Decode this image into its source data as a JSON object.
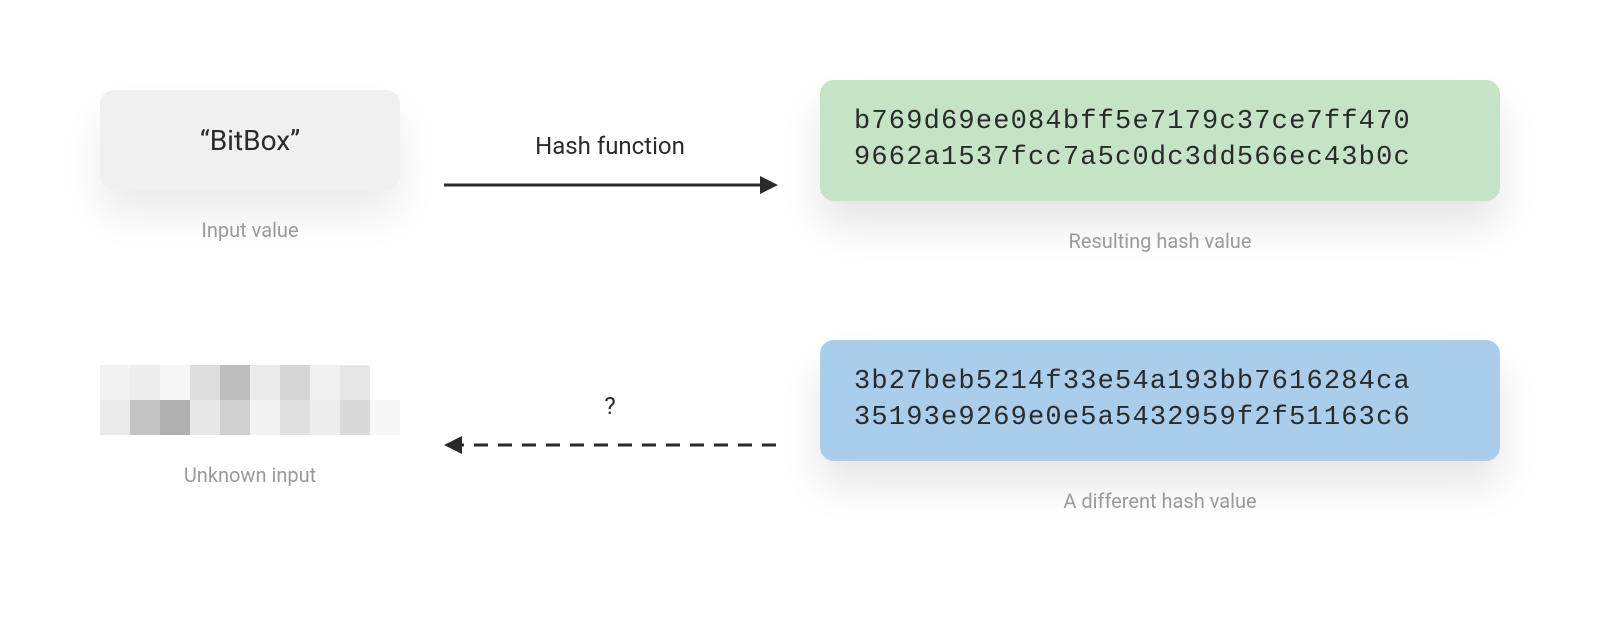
{
  "row1": {
    "input_text": "“BitBox”",
    "input_caption": "Input value",
    "arrow_label": "Hash function",
    "hash_line1": "b769d69ee084bff5e7179c37ce7ff470",
    "hash_line2": "9662a1537fcc7a5c0dc3dd566ec43b0c",
    "hash_caption": "Resulting hash value"
  },
  "row2": {
    "unknown_caption": "Unknown input",
    "arrow_label": "?",
    "hash_line1": "3b27beb5214f33e54a193bb7616284ca",
    "hash_line2": "35193e9269e0e5a5432959f2f51163c6",
    "hash_caption": "A different hash value"
  },
  "colors": {
    "input_bg": "#f0f0f0",
    "hash_green": "#c5e4c6",
    "hash_blue": "#a9cdea",
    "caption": "#9a9a9a",
    "text": "#2a2a2a"
  }
}
